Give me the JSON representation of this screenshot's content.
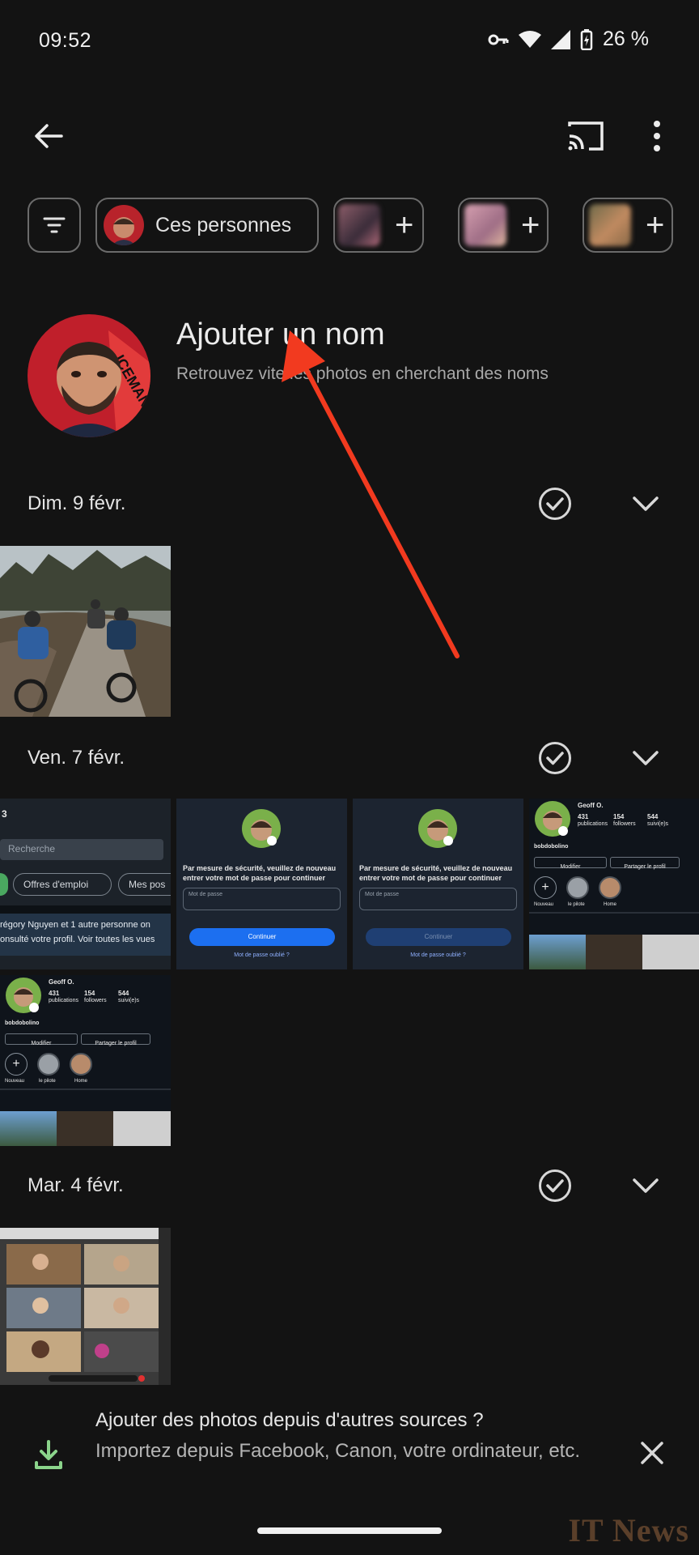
{
  "status_bar": {
    "time": "09:52",
    "battery": "26 %"
  },
  "header": {
    "back_icon": "arrow-left-icon",
    "cast_icon": "cast-icon",
    "menu_icon": "more-vert-icon"
  },
  "chips": {
    "filter_icon": "filter-icon",
    "people_label": "Ces personnes"
  },
  "hero": {
    "title": "Ajouter un nom",
    "subtitle": "Retrouvez vite les photos en cherchant des noms"
  },
  "sections": [
    {
      "date": "Dim. 9 févr."
    },
    {
      "date": "Ven. 7 févr."
    },
    {
      "date": "Mar. 4 févr."
    }
  ],
  "thumbnails": {
    "linkedin": {
      "status": "3",
      "search": "Recherche",
      "chip1": "Offres d'emploi",
      "chip2": "Mes pos",
      "notification": "régory Nguyen et 1 autre personne on",
      "notification2": "onsulté votre profil. Voir toutes les vues"
    },
    "instagram_login": {
      "message": "Par mesure de sécurité, veuillez de nouveau entrer votre mot de passe pour continuer",
      "placeholder": "Mot de passe",
      "button": "Continuer",
      "forgot": "Mot de passe oublié ?"
    },
    "instagram_profile": {
      "name": "Geoff O.",
      "posts": "431",
      "posts_label": "publications",
      "followers": "154",
      "followers_label": "followers",
      "following": "544",
      "following_label": "suivi(e)s",
      "username": "bobdobolino",
      "edit": "Modifier",
      "share": "Partager le profil",
      "story1": "Nouveau",
      "story2": "le pilote",
      "story3": "Home"
    }
  },
  "banner": {
    "title": "Ajouter des photos depuis d'autres sources ?",
    "subtitle": "Importez depuis Facebook, Canon, votre ordinateur, etc."
  },
  "watermark": "IT News",
  "colors": {
    "background": "#131313",
    "accent_green": "#8bd48b",
    "arrow_red": "#f23a1f",
    "ig_blue": "#1c6ff0"
  }
}
